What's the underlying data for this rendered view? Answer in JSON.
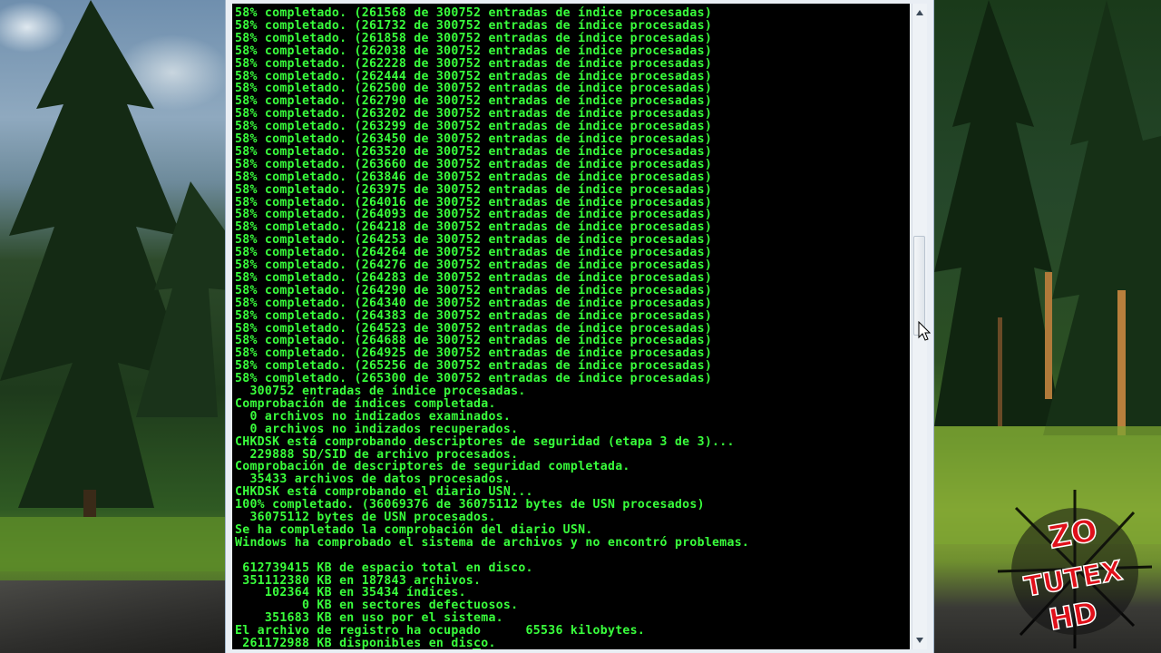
{
  "console": {
    "cursor": {
      "line": 50,
      "column": 32
    },
    "lines": [
      "58% completado. (261568 de 300752 entradas de índice procesadas)",
      "58% completado. (261732 de 300752 entradas de índice procesadas)",
      "58% completado. (261858 de 300752 entradas de índice procesadas)",
      "58% completado. (262038 de 300752 entradas de índice procesadas)",
      "58% completado. (262228 de 300752 entradas de índice procesadas)",
      "58% completado. (262444 de 300752 entradas de índice procesadas)",
      "58% completado. (262500 de 300752 entradas de índice procesadas)",
      "58% completado. (262790 de 300752 entradas de índice procesadas)",
      "58% completado. (263202 de 300752 entradas de índice procesadas)",
      "58% completado. (263299 de 300752 entradas de índice procesadas)",
      "58% completado. (263450 de 300752 entradas de índice procesadas)",
      "58% completado. (263520 de 300752 entradas de índice procesadas)",
      "58% completado. (263660 de 300752 entradas de índice procesadas)",
      "58% completado. (263846 de 300752 entradas de índice procesadas)",
      "58% completado. (263975 de 300752 entradas de índice procesadas)",
      "58% completado. (264016 de 300752 entradas de índice procesadas)",
      "58% completado. (264093 de 300752 entradas de índice procesadas)",
      "58% completado. (264218 de 300752 entradas de índice procesadas)",
      "58% completado. (264253 de 300752 entradas de índice procesadas)",
      "58% completado. (264264 de 300752 entradas de índice procesadas)",
      "58% completado. (264276 de 300752 entradas de índice procesadas)",
      "58% completado. (264283 de 300752 entradas de índice procesadas)",
      "58% completado. (264290 de 300752 entradas de índice procesadas)",
      "58% completado. (264340 de 300752 entradas de índice procesadas)",
      "58% completado. (264383 de 300752 entradas de índice procesadas)",
      "58% completado. (264523 de 300752 entradas de índice procesadas)",
      "58% completado. (264688 de 300752 entradas de índice procesadas)",
      "58% completado. (264925 de 300752 entradas de índice procesadas)",
      "58% completado. (265256 de 300752 entradas de índice procesadas)",
      "58% completado. (265300 de 300752 entradas de índice procesadas)",
      "  300752 entradas de índice procesadas.",
      "Comprobación de índices completada.",
      "  0 archivos no indizados examinados.",
      "  0 archivos no indizados recuperados.",
      "CHKDSK está comprobando descriptores de seguridad (etapa 3 de 3)...",
      "  229888 SD/SID de archivo procesados.",
      "Comprobación de descriptores de seguridad completada.",
      "  35433 archivos de datos procesados.",
      "CHKDSK está comprobando el diario USN...",
      "100% completado. (36069376 de 36075112 bytes de USN procesados)",
      "  36075112 bytes de USN procesados.",
      "Se ha completado la comprobación del diario USN.",
      "Windows ha comprobado el sistema de archivos y no encontró problemas.",
      "",
      " 612739415 KB de espacio total en disco.",
      " 351112380 KB en 187843 archivos.",
      "    102364 KB en 35434 índices.",
      "         0 KB en sectores defectuosos.",
      "    351683 KB en uso por el sistema.",
      "El archivo de registro ha ocupado      65536 kilobytes.",
      " 261172988 KB disponibles en disco."
    ]
  },
  "scrollbar": {
    "position": 0.42
  },
  "logo": {
    "line1": "ZO",
    "line2": "TUTEX",
    "line3": "HD"
  },
  "colors": {
    "console_text": "#39ff3c",
    "console_bg": "#000000",
    "logo_red": "#e0101a"
  }
}
